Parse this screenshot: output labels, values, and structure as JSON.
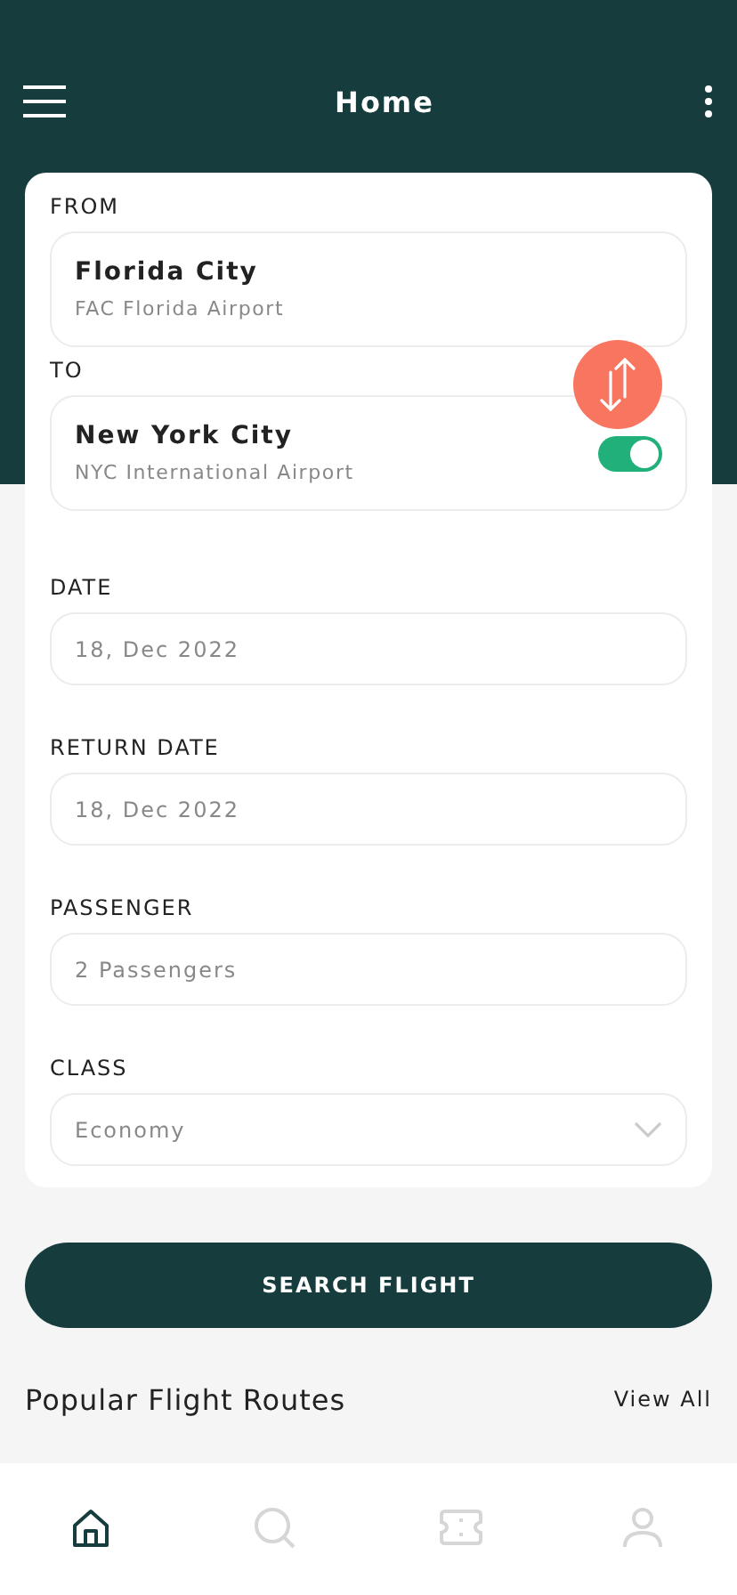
{
  "header": {
    "title": "Home"
  },
  "fields": [
    {
      "kind": "place",
      "label": "FROM",
      "city": "Florida City",
      "airport": "FAC Florida Airport"
    },
    {
      "kind": "place",
      "label": "TO",
      "city": "New York City",
      "airport": "NYC International Airport",
      "toggle": {
        "on": true
      }
    },
    {
      "kind": "input",
      "label": "DATE",
      "value": "18, Dec 2022"
    },
    {
      "kind": "input",
      "label": "RETURN DATE",
      "value": "18, Dec 2022"
    },
    {
      "kind": "input",
      "label": "PASSENGER",
      "value": "2 Passengers"
    },
    {
      "kind": "select",
      "label": "CLASS",
      "value": "Economy"
    }
  ],
  "search_button": "SEARCH FLIGHT",
  "section": {
    "title": "Popular Flight Routes",
    "link": "View All"
  },
  "nav": [
    {
      "kind": "home",
      "selected": true
    },
    {
      "kind": "search",
      "selected": false
    },
    {
      "kind": "ticket",
      "selected": false
    },
    {
      "kind": "profile",
      "selected": false
    }
  ]
}
